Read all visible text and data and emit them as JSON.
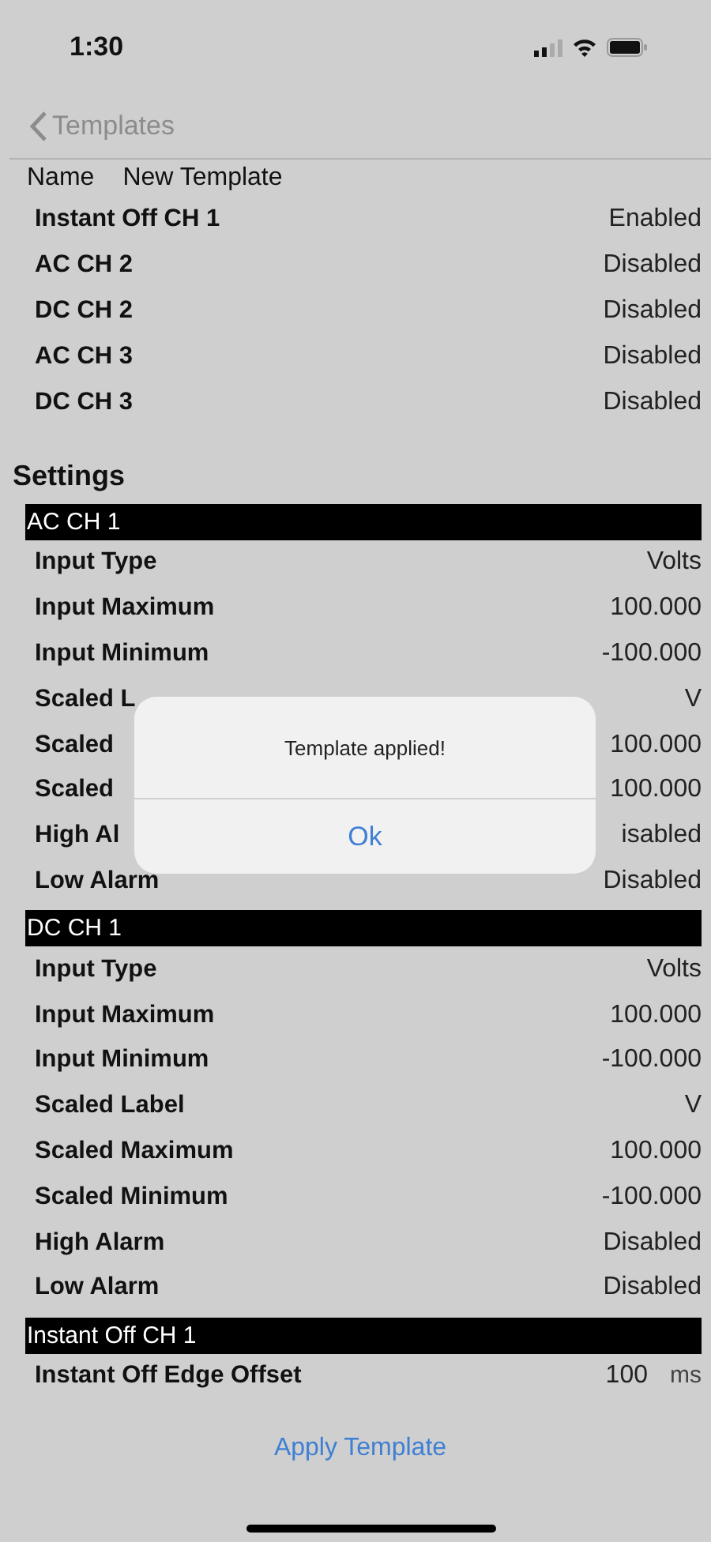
{
  "status_bar": {
    "time": "1:30"
  },
  "nav": {
    "back_label": "Templates"
  },
  "template": {
    "name_label": "Name",
    "name_value": "New Template"
  },
  "channels": [
    {
      "label": "Instant Off CH 1",
      "value": "Enabled"
    },
    {
      "label": "AC CH 2",
      "value": "Disabled"
    },
    {
      "label": "DC CH 2",
      "value": "Disabled"
    },
    {
      "label": "AC CH 3",
      "value": "Disabled"
    },
    {
      "label": "DC CH 3",
      "value": "Disabled"
    }
  ],
  "settings": {
    "title": "Settings",
    "sections": [
      {
        "header": "AC CH 1",
        "rows": [
          {
            "label": "Input Type",
            "value": "Volts"
          },
          {
            "label": "Input Maximum",
            "value": "100.000"
          },
          {
            "label": "Input Minimum",
            "value": "-100.000"
          },
          {
            "label": "Scaled L",
            "value": "V"
          },
          {
            "label": "Scaled",
            "value": "100.000"
          },
          {
            "label": "Scaled",
            "value": "100.000"
          },
          {
            "label": "High Al",
            "value": "isabled"
          },
          {
            "label": "Low Alarm",
            "value": "Disabled"
          }
        ]
      },
      {
        "header": "DC CH 1",
        "rows": [
          {
            "label": "Input Type",
            "value": "Volts"
          },
          {
            "label": "Input Maximum",
            "value": "100.000"
          },
          {
            "label": "Input Minimum",
            "value": "-100.000"
          },
          {
            "label": "Scaled Label",
            "value": "V"
          },
          {
            "label": "Scaled Maximum",
            "value": "100.000"
          },
          {
            "label": "Scaled Minimum",
            "value": "-100.000"
          },
          {
            "label": "High Alarm",
            "value": "Disabled"
          },
          {
            "label": "Low Alarm",
            "value": "Disabled"
          }
        ]
      },
      {
        "header": "Instant Off CH 1",
        "rows": [
          {
            "label": "Instant Off Edge Offset",
            "value": "100",
            "unit": "ms"
          }
        ]
      }
    ]
  },
  "apply_button": "Apply Template",
  "alert": {
    "message": "Template applied!",
    "button": "Ok"
  }
}
